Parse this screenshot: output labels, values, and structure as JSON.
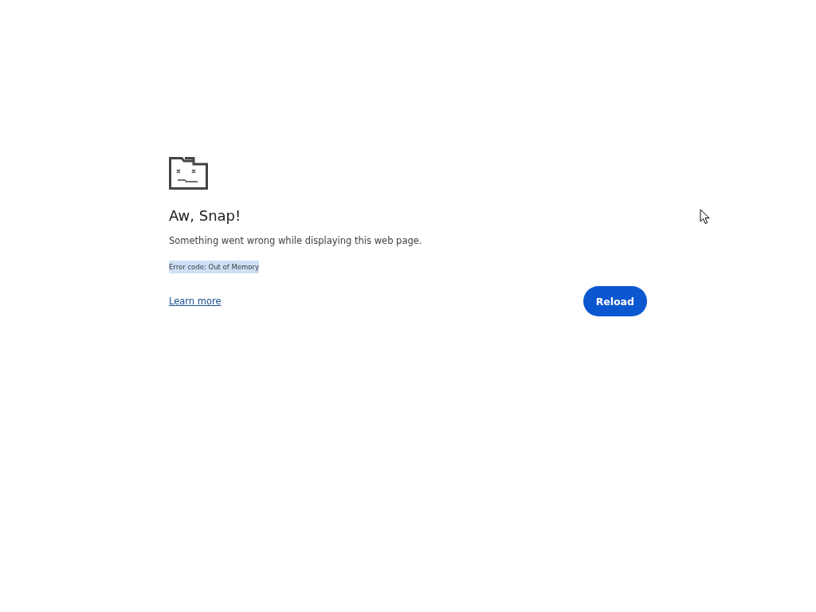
{
  "error_page": {
    "title": "Aw, Snap!",
    "message": "Something went wrong while displaying this web page.",
    "error_code": {
      "text": "Error code: Out of Memory",
      "selected": true
    },
    "learn_more": "Learn more",
    "reload_button": "Reload"
  }
}
